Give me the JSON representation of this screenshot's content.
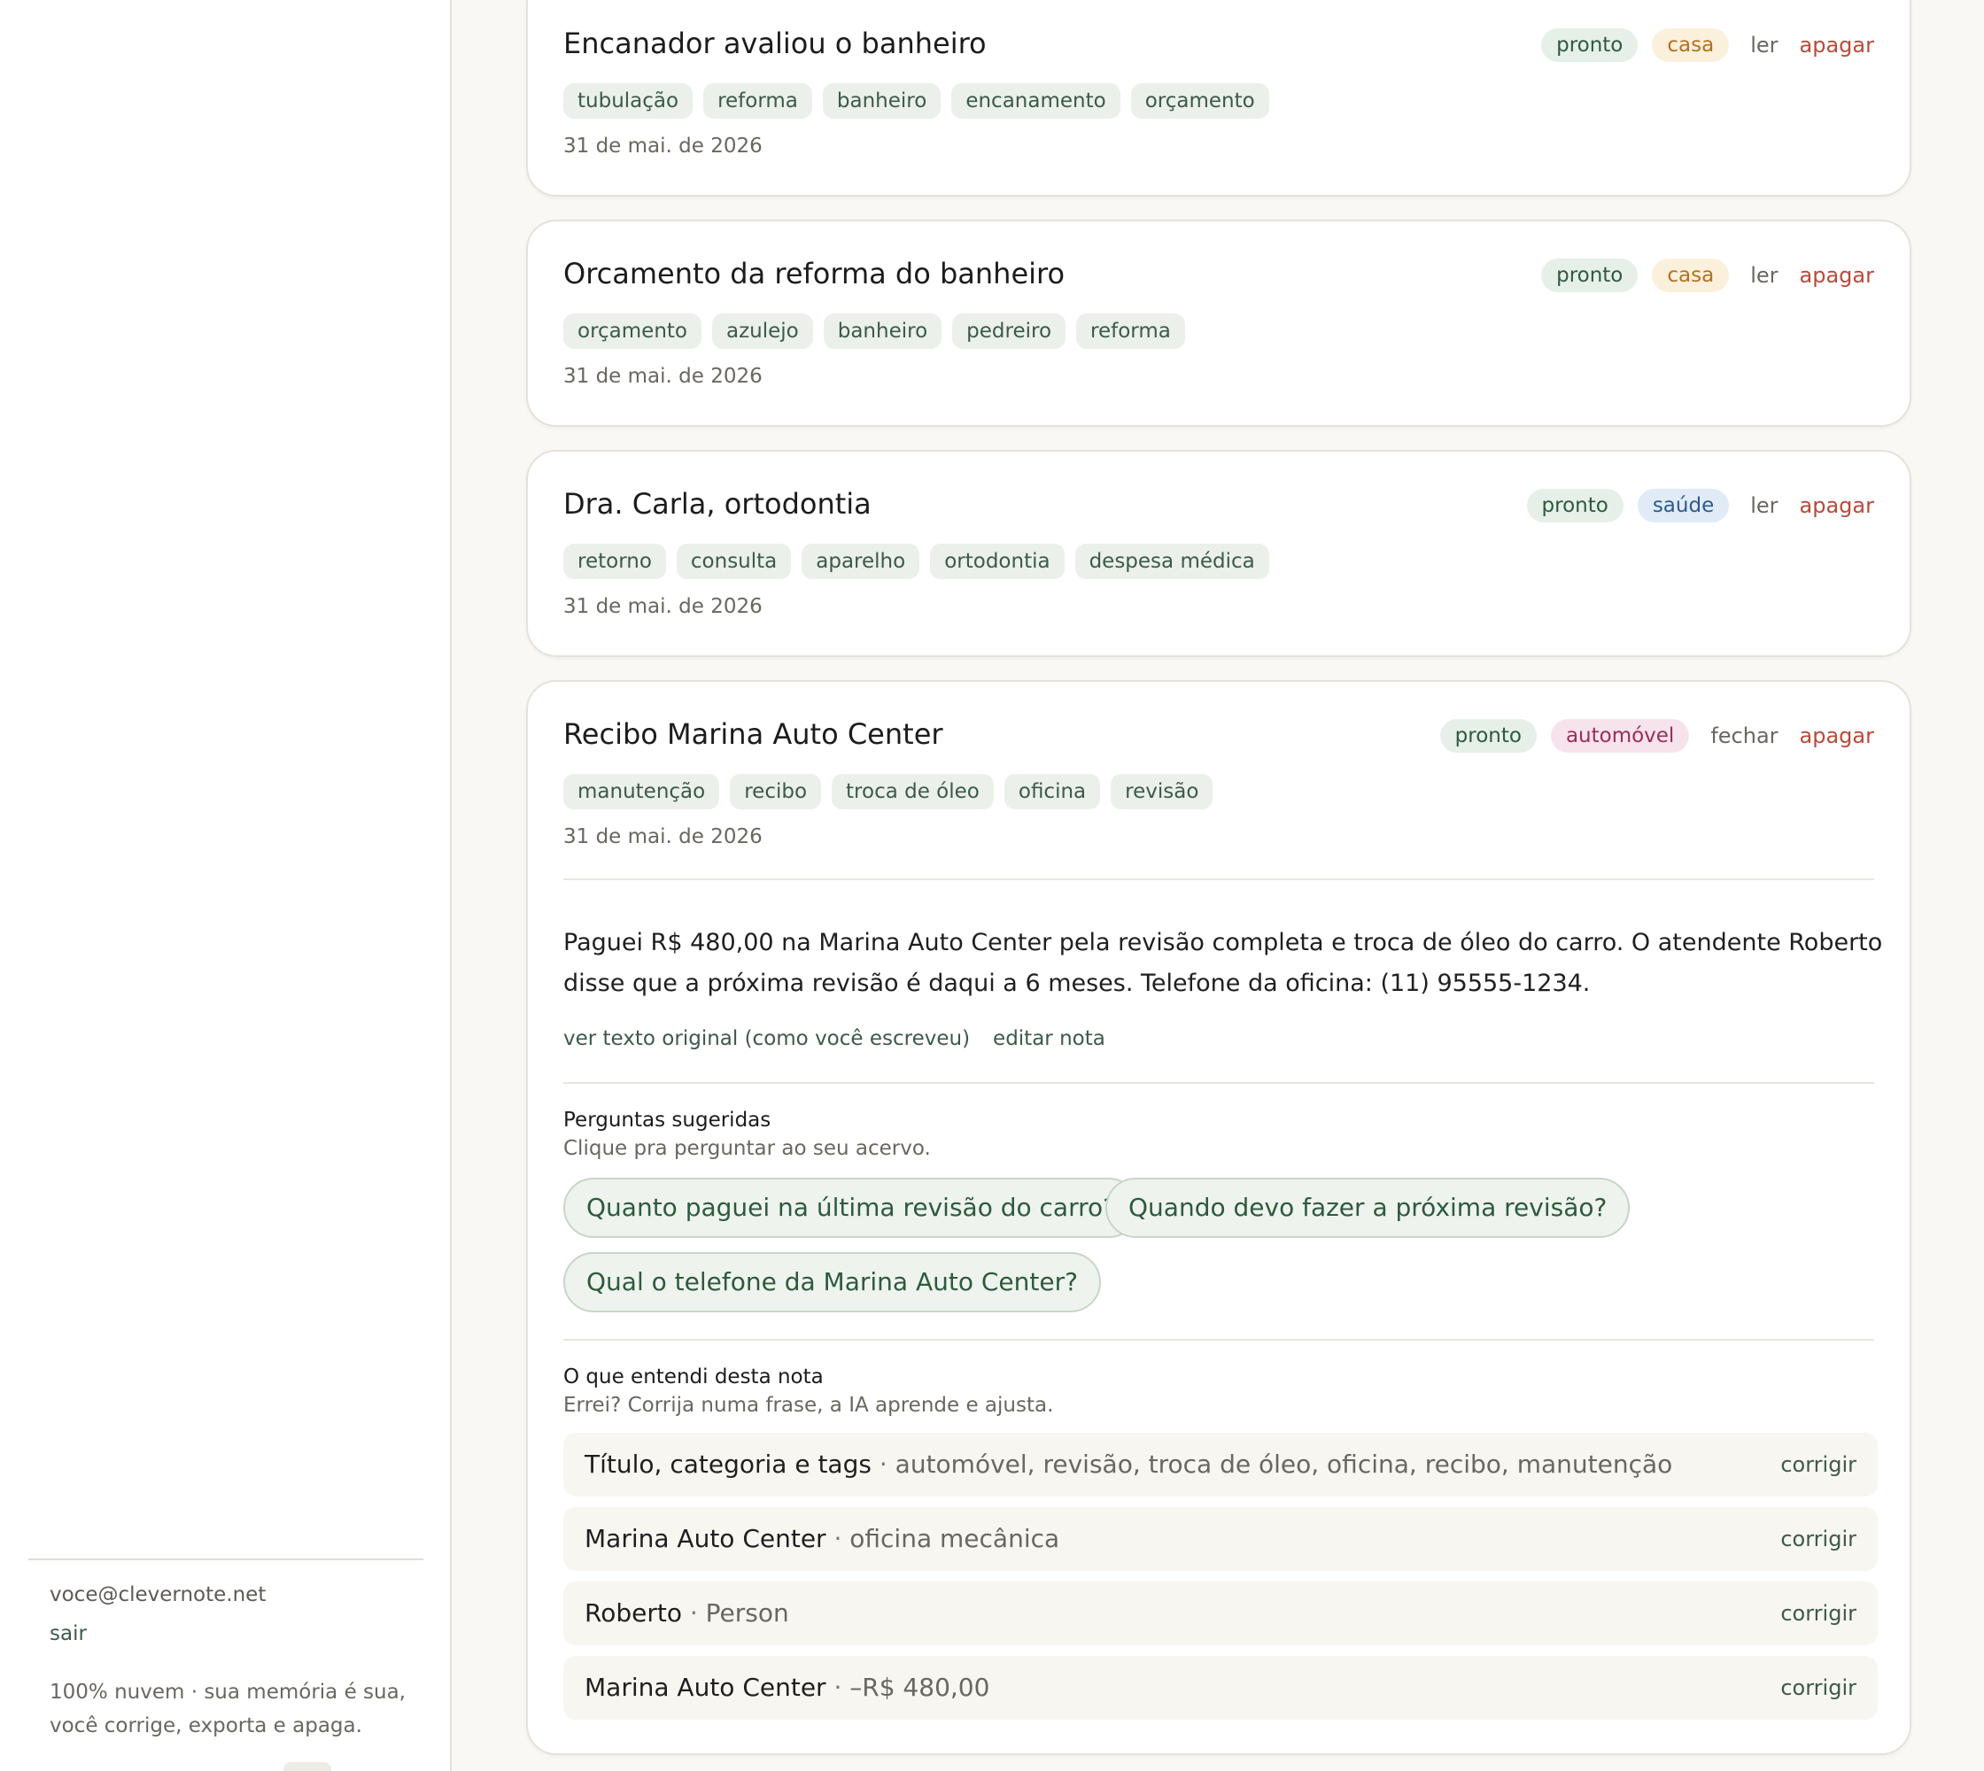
{
  "sidebar": {
    "account_email": "voce@clevernote.net",
    "logout_label": "sair",
    "footer_text": "100% nuvem · sua memória é sua, você corrige, exporta e apaga."
  },
  "notes": [
    {
      "title": "Encanador avaliou o banheiro",
      "status": "pronto",
      "category": "casa",
      "action": "ler",
      "delete": "apagar",
      "tags": [
        "tubulação",
        "reforma",
        "banheiro",
        "encanamento",
        "orçamento"
      ],
      "date": "31 de mai. de 2026"
    },
    {
      "title": "Orcamento da reforma do banheiro",
      "status": "pronto",
      "category": "casa",
      "action": "ler",
      "delete": "apagar",
      "tags": [
        "orçamento",
        "azulejo",
        "banheiro",
        "pedreiro",
        "reforma"
      ],
      "date": "31 de mai. de 2026"
    },
    {
      "title": "Dra. Carla, ortodontia",
      "status": "pronto",
      "category": "saúde",
      "action": "ler",
      "delete": "apagar",
      "tags": [
        "retorno",
        "consulta",
        "aparelho",
        "ortodontia",
        "despesa médica"
      ],
      "date": "31 de mai. de 2026"
    },
    {
      "title": "Recibo Marina Auto Center",
      "status": "pronto",
      "category": "automóvel",
      "action": "fechar",
      "delete": "apagar",
      "tags": [
        "manutenção",
        "recibo",
        "troca de óleo",
        "oficina",
        "revisão"
      ],
      "date": "31 de mai. de 2026",
      "body": "Paguei R$ 480,00 na Marina Auto Center pela revisão completa e troca de óleo do carro. O atendente Roberto disse que a próxima revisão é daqui a 6 meses. Telefone da oficina: (11) 95555-1234.",
      "links": {
        "original": "ver texto original (como você escreveu)",
        "edit": "editar nota"
      },
      "suggested": {
        "title": "Perguntas sugeridas",
        "subtitle": "Clique pra perguntar ao seu acervo.",
        "questions": [
          "Quanto paguei na última revisão do carro?",
          "Quando devo fazer a próxima revisão?",
          "Qual o telefone da Marina Auto Center?"
        ]
      },
      "understood": {
        "title": "O que entendi desta nota",
        "subtitle": "Errei? Corrija numa frase, a IA aprende e ajusta.",
        "separator": " · ",
        "fix_label": "corrigir",
        "facts": [
          {
            "key": "Título, categoria e tags",
            "value": "automóvel, revisão, troca de óleo, oficina, recibo, manutenção"
          },
          {
            "key": "Marina Auto Center",
            "value": "oficina mecânica"
          },
          {
            "key": "Roberto",
            "value": "Person"
          },
          {
            "key": "Marina Auto Center",
            "value": "–R$ 480,00"
          }
        ]
      }
    }
  ]
}
